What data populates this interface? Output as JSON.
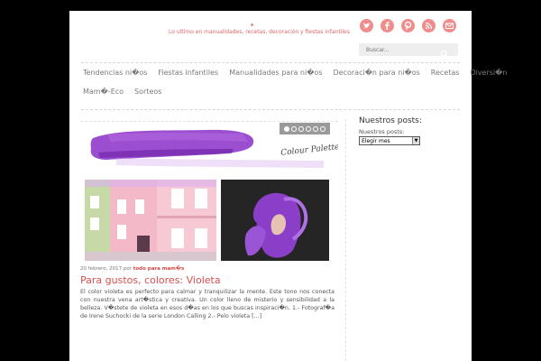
{
  "header": {
    "tagline": "Lo ultimo en manualidades, recetas, decoración y fiestas infantiles",
    "social_icons": [
      "twitter-icon",
      "facebook-icon",
      "pinterest-icon",
      "rss-icon",
      "email-icon"
    ],
    "search_placeholder": "Buscar..."
  },
  "nav": {
    "row1": [
      "Tendencias ni�os",
      "Fiestas infantiles",
      "Manualidades para ni�os",
      "Decoraci�n para ni�os",
      "Recetas",
      "Diversi�n"
    ],
    "row2": [
      "Mam�-Eco",
      "Sorteos"
    ]
  },
  "post": {
    "banner_text": "Colour Palette",
    "carousel_dots": 6,
    "carousel_active": 0,
    "date": "20 febrero, 2017",
    "by": "por",
    "author": "todo para mam�s",
    "title": "Para gustos, colores: Violeta",
    "excerpt": "El color violeta es perfecto para calmar y tranquilizar la mente. Este tono nos conecta con nuestra vena art�stica y creativa. Un color lleno de misterio y sensibilidad a la belleza. V�stete de violeta en esos d�as en los que buscas inspiraci�n. 1.- Fotograf�a de Irene Suchocki de la serie London Calling 2.- Pelo violeta [...]"
  },
  "sidebar": {
    "title": "Nuestros posts:",
    "label": "Nuestros posts:",
    "select_value": "Elegir mes"
  },
  "colors": {
    "accent": "#d94f4f",
    "social": "#f08c8c",
    "violet": "#8b2fc9"
  }
}
